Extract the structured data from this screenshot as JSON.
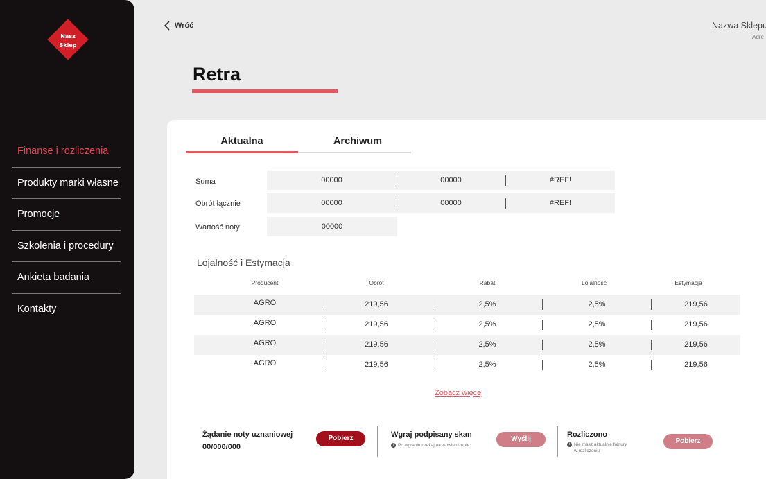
{
  "sidebar": {
    "logo_line1": "Nasz",
    "logo_line2": "Sklep",
    "items": [
      {
        "label": "Finanse i rozliczenia"
      },
      {
        "label": "Produkty marki własne"
      },
      {
        "label": "Promocje"
      },
      {
        "label": "Szkolenia i procedury"
      },
      {
        "label": "Ankieta badania"
      },
      {
        "label": "Kontakty"
      }
    ],
    "active_color": "#e8404f",
    "background": "#141012"
  },
  "header": {
    "back_label": "Wróć",
    "shop_name": "Nazwa Sklepu",
    "shop_address": "Adre"
  },
  "page": {
    "title": "Retra",
    "accent": "#e8565f"
  },
  "tabs": [
    {
      "label": "Aktualna",
      "active": true
    },
    {
      "label": "Archiwum",
      "active": false
    }
  ],
  "summary": [
    {
      "label": "Suma",
      "values": [
        "00000",
        "00000",
        "#REF!"
      ]
    },
    {
      "label": "Obrót łącznie",
      "values": [
        "00000",
        "00000",
        "#REF!"
      ]
    },
    {
      "label": "Wartość noty",
      "values": [
        "00000"
      ]
    }
  ],
  "loyalty": {
    "title": "Lojalność i Estymacja",
    "columns": [
      "Producent",
      "Obrót",
      "Rabat",
      "Lojalność",
      "Estymacja"
    ],
    "rows": [
      [
        "AGRO",
        "219,56",
        "2,5%",
        "2,5%",
        "219,56"
      ],
      [
        "AGRO",
        "219,56",
        "2,5%",
        "2,5%",
        "219,56"
      ],
      [
        "AGRO",
        "219,56",
        "2,5%",
        "2,5%",
        "219,56"
      ],
      [
        "AGRO",
        "219,56",
        "2,5%",
        "2,5%",
        "219,56"
      ]
    ],
    "more_label": "Zobacz więcej"
  },
  "footer": {
    "request": {
      "title": "Żądanie noty uznaniowej",
      "value": "00/000/000",
      "button": "Pobierz",
      "button_color": "#a3101c"
    },
    "upload": {
      "title": "Wgraj podpisany skan",
      "note": "Po wgraniu czekaj na zatwierdzenie",
      "button": "Wyślij",
      "button_color": "#cf7d86"
    },
    "settled": {
      "title": "Rozliczono",
      "note_line1": "Nie masz aktualnie faktury",
      "note_line2": "w rozliczeniu",
      "button": "Pobierz",
      "button_color": "#cf7d86"
    }
  }
}
